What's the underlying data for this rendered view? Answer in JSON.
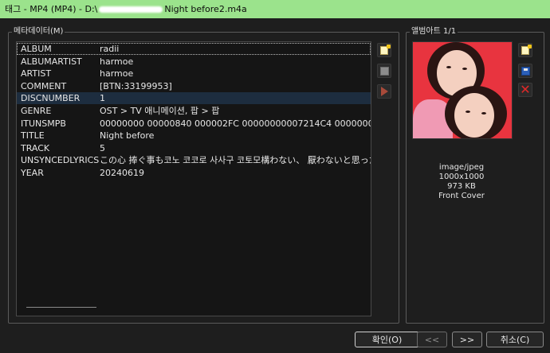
{
  "window": {
    "title_prefix": "태그 - MP4 (MP4) - D:\\",
    "title_suffix": "Night before2.m4a"
  },
  "metadata": {
    "group_label": "메타데이터(M)",
    "rows": [
      {
        "key": "ALBUM",
        "value": "radii"
      },
      {
        "key": "ALBUMARTIST",
        "value": "harmoe"
      },
      {
        "key": "ARTIST",
        "value": "harmoe"
      },
      {
        "key": "COMMENT",
        "value": "[BTN:33199953]"
      },
      {
        "key": "DISCNUMBER",
        "value": "1"
      },
      {
        "key": "GENRE",
        "value": "OST  > TV 애니메이션, 팝 > 팝"
      },
      {
        "key": "ITUNSMPB",
        "value": " 00000000 00000840 000002FC 00000000007214C4 00000000 00000000"
      },
      {
        "key": "TITLE",
        "value": "Night before"
      },
      {
        "key": "TRACK",
        "value": "5"
      },
      {
        "key": "UNSYNCEDLYRICS",
        "value": "この心  捧ぐ事も코노 코코로 사사구 코토모構わない、  厭わないと思った"
      },
      {
        "key": "YEAR",
        "value": "20240619"
      }
    ],
    "selected_index": 0,
    "highlighted_index": 4
  },
  "album_art": {
    "group_label": "앨범아트 1/1",
    "mime": "image/jpeg",
    "dimensions": "1000x1000",
    "size": "973 KB",
    "type": "Front Cover"
  },
  "buttons": {
    "ok": "확인(O)",
    "prev": "<<",
    "next": ">>",
    "cancel": "취소(C)"
  },
  "colors": {
    "titlebar": "#9be38c",
    "background": "#1e1e1e",
    "highlight_row": "#1d2d3f"
  }
}
